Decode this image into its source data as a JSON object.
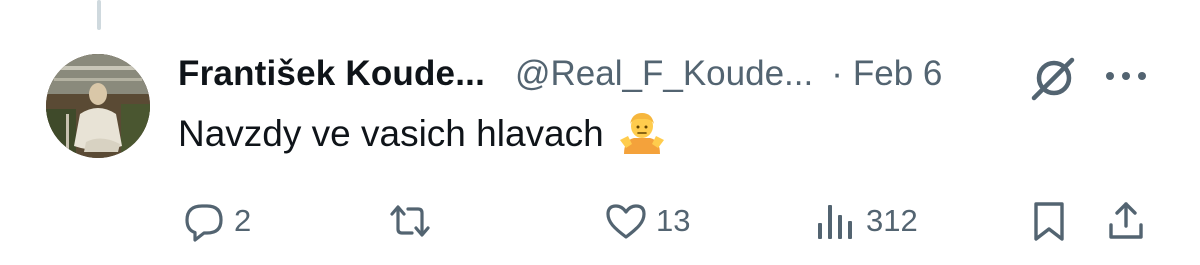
{
  "tweet": {
    "author_name": "František Koude...",
    "author_handle": "@Real_F_Koude...",
    "separator": "·",
    "timestamp": "Feb 6",
    "text": "Navzdy ve vasich hlavach",
    "emoji": "person-shrugging-emoji"
  },
  "actions": {
    "replies": "2",
    "reposts": "",
    "likes": "13",
    "views": "312"
  },
  "icons": {
    "reply": "reply-icon",
    "repost": "repost-icon",
    "like": "heart-icon",
    "views": "views-icon",
    "bookmark": "bookmark-icon",
    "share": "share-icon",
    "grok": "grok-icon",
    "more": "more-icon"
  },
  "colors": {
    "text": "#0f1419",
    "secondary": "#536471",
    "thread_line": "#cfd9de"
  }
}
